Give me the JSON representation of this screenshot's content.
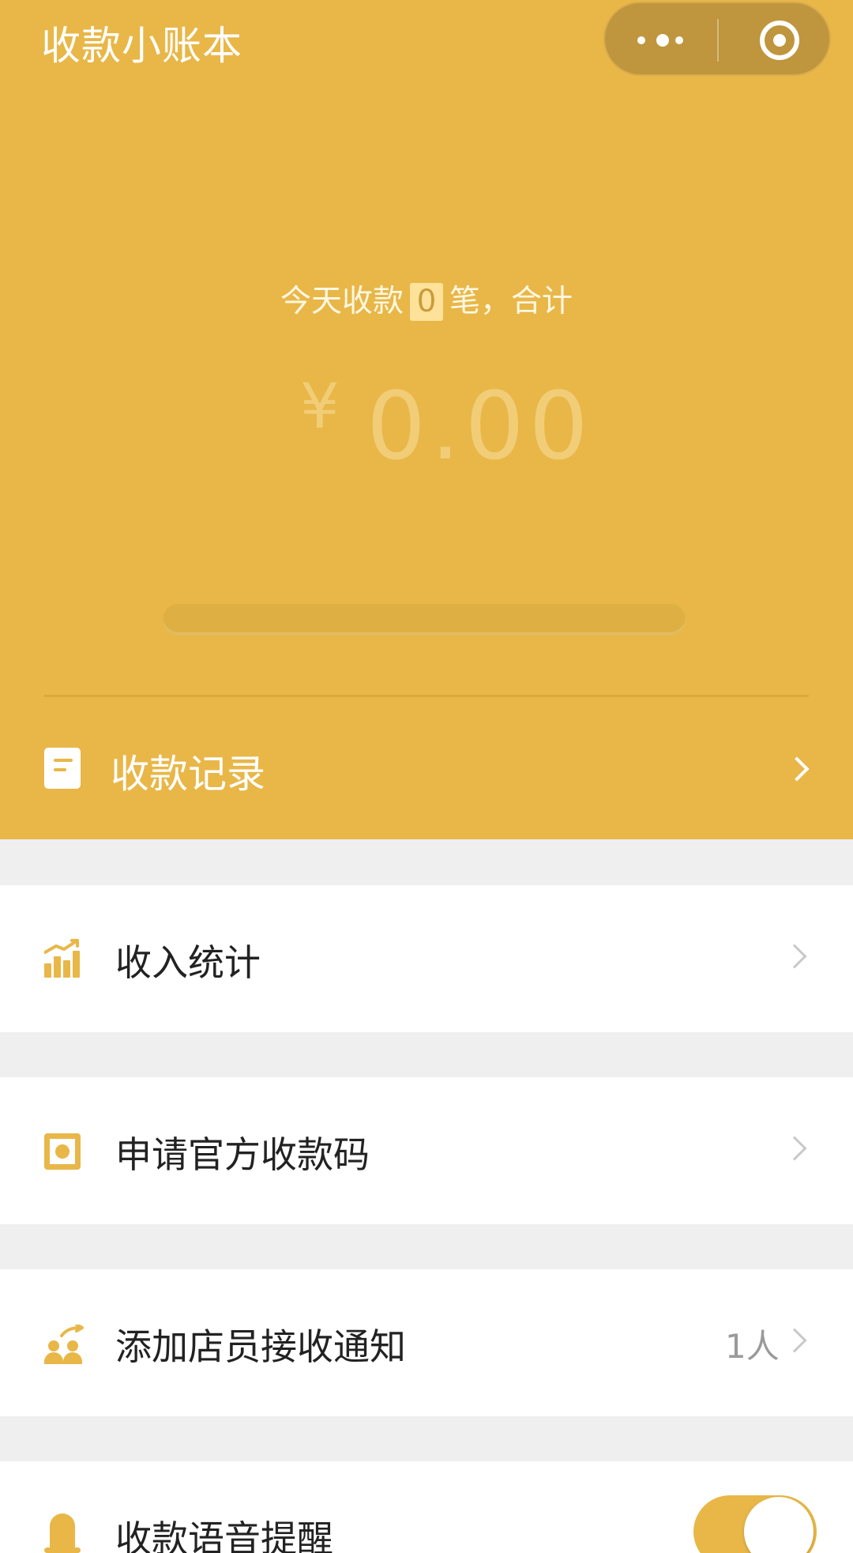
{
  "header": {
    "title": "收款小账本"
  },
  "summary": {
    "prefix": "今天收款",
    "transaction_count": "0",
    "suffix": "笔，合计",
    "currency_symbol": "¥",
    "amount": "0.00",
    "progress": 0
  },
  "records": {
    "label": "收款记录",
    "icon": "document-icon"
  },
  "menu": {
    "income_stats": {
      "label": "收入统计",
      "icon": "chart-icon"
    },
    "apply_qr": {
      "label": "申请官方收款码",
      "icon": "qr-code-icon"
    },
    "staff_notifications": {
      "label": "添加店员接收通知",
      "count": "1人",
      "icon": "staff-icon"
    },
    "voice_reminder": {
      "label": "收款语音提醒",
      "icon": "bell-icon",
      "enabled": true
    }
  },
  "colors": {
    "primary": "#e8b748",
    "background": "#efefef",
    "card": "#ffffff",
    "text": "#222222",
    "muted": "#9a9a9a"
  }
}
